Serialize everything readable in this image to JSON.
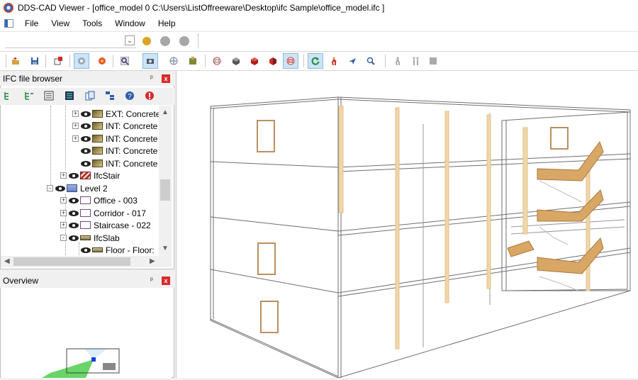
{
  "window": {
    "title": "DDS-CAD Viewer - [office_model  0  C:\\Users\\ListOffreeware\\Desktop\\ifc Sample\\office_model.ifc ]",
    "app_icon": "dds-cad-viewer-icon"
  },
  "menu": {
    "items": [
      "File",
      "View",
      "Tools",
      "Window",
      "Help"
    ]
  },
  "toolbar": {
    "icons": [
      "open-folder-icon",
      "save-icon",
      "export-icon",
      "view-mode-icon",
      "render-mode-icon",
      "zoom-window-icon",
      "camera-icon",
      "orbit-icon",
      "object-tree-icon",
      "box-white-icon",
      "box-dark-icon",
      "box-red-icon",
      "box-red-alt-icon",
      "section-box-icon",
      "refresh-icon",
      "walk-icon",
      "fly-icon",
      "search-icon",
      "person-disabled-icon",
      "persons-disabled-icon",
      "stop-icon"
    ]
  },
  "ifc_browser": {
    "title": "IFC file browser",
    "pin": "ᵖ",
    "close": "x",
    "tools": [
      "tree-expand-icon",
      "tree-collapse-icon",
      "list-icon",
      "properties-icon",
      "copy-icon",
      "hierarchy-icon",
      "help-icon",
      "error-icon"
    ],
    "tree": [
      {
        "label": "EXT: Concrete",
        "type": "wall",
        "expander": "+"
      },
      {
        "label": "INT: Concrete",
        "type": "wall",
        "expander": "+"
      },
      {
        "label": "INT: Concrete",
        "type": "wall",
        "expander": "+"
      },
      {
        "label": "INT: Concrete",
        "type": "wall",
        "expander": ""
      },
      {
        "label": "INT: Concrete",
        "type": "wall",
        "expander": ""
      },
      {
        "label": "IfcStair",
        "type": "stair",
        "expander": "+"
      },
      {
        "label": "Level 2",
        "type": "level",
        "expander": "-"
      },
      {
        "label": "Office - 003",
        "type": "space",
        "expander": "+"
      },
      {
        "label": "Corridor - 017",
        "type": "space",
        "expander": "+"
      },
      {
        "label": "Staircase - 022",
        "type": "space",
        "expander": "+"
      },
      {
        "label": "IfcSlab",
        "type": "slab",
        "expander": "-"
      },
      {
        "label": "Floor - Floor:",
        "type": "slab",
        "expander": ""
      }
    ]
  },
  "overview": {
    "title": "Overview",
    "pin": "ᵖ",
    "close": "x"
  },
  "colors": {
    "window_bg": "#f0f0f0",
    "toolbar_pressed": "#cce4f7",
    "wireframe": "#6e6e6e",
    "stair_fill": "#d9a765",
    "column_fill": "#f0d6a8",
    "close_red": "#d9292b",
    "overview_green": "#5fd35f"
  }
}
